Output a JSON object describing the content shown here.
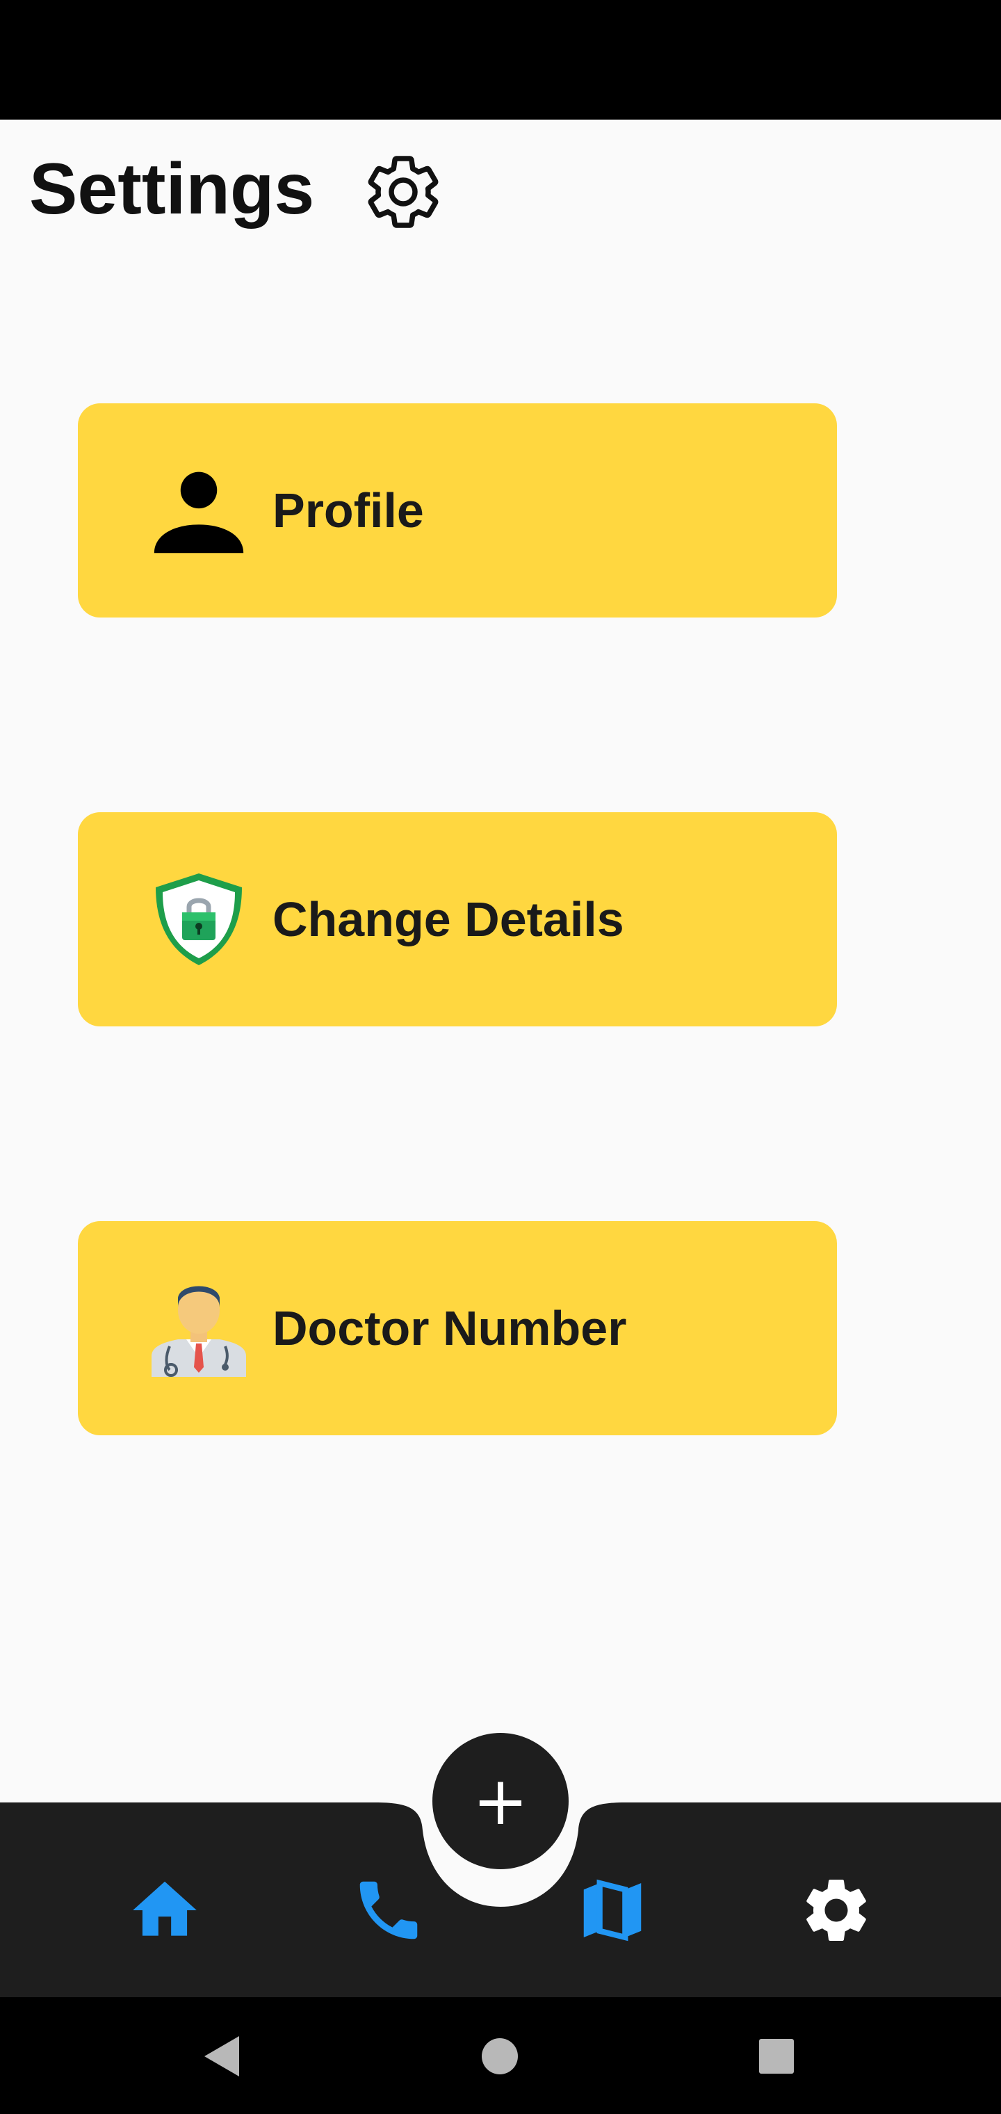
{
  "header": {
    "title": "Settings",
    "icon": "gear-icon"
  },
  "menu": {
    "items": [
      {
        "label": "Profile",
        "icon": "person-icon"
      },
      {
        "label": "Change Details",
        "icon": "shield-lock-icon"
      },
      {
        "label": "Doctor Number",
        "icon": "doctor-icon"
      }
    ]
  },
  "colors": {
    "card": "#ffd740",
    "nav_bar": "#1e1e1e",
    "nav_active": "#2196f3",
    "nav_inactive": "#ffffff",
    "background": "#fafafa"
  },
  "bottom_nav": {
    "items": [
      {
        "icon": "home-icon",
        "color": "#2196f3"
      },
      {
        "icon": "phone-icon",
        "color": "#2196f3"
      },
      {
        "icon": "map-icon",
        "color": "#2196f3"
      },
      {
        "icon": "settings-icon",
        "color": "#ffffff"
      }
    ],
    "fab": {
      "label": "+",
      "icon": "plus-icon"
    }
  },
  "system_nav": {
    "items": [
      "back-icon",
      "home-circle-icon",
      "recents-icon"
    ]
  }
}
